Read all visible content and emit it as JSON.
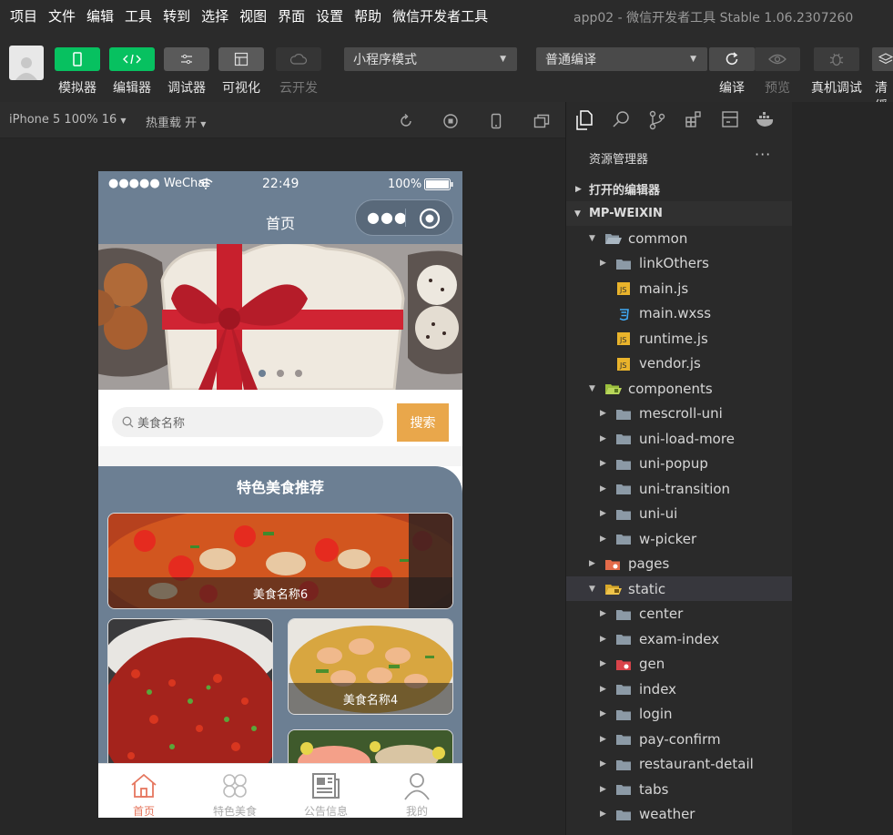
{
  "menu": [
    "项目",
    "文件",
    "编辑",
    "工具",
    "转到",
    "选择",
    "视图",
    "界面",
    "设置",
    "帮助",
    "微信开发者工具"
  ],
  "window_title": "app02 - 微信开发者工具 Stable 1.06.2307260",
  "toolbar": {
    "simulator": "模拟器",
    "editor": "编辑器",
    "debugger": "调试器",
    "visual": "可视化",
    "cloud": "云开发",
    "mode": "小程序模式",
    "compile": "普通编译",
    "compile_btn": "编译",
    "preview": "预览",
    "real_debug": "真机调试",
    "clear": "清缓"
  },
  "colors": {
    "green": "#07c160",
    "accent_nav": "#6c7f93",
    "search_btn": "#e9a74b",
    "tab_active": "#e5765e"
  },
  "simbar": {
    "device": "iPhone 5 100% 16",
    "hot_reload": "热重载 开"
  },
  "phone": {
    "status": {
      "signal": "●●●●● WeChat",
      "time": "22:49",
      "battery": "100%"
    },
    "nav_title": "首页",
    "search_placeholder": "美食名称",
    "search_button": "搜索",
    "section_title": "特色美食推荐",
    "cards": [
      {
        "label": "美食名称6"
      },
      {
        "label": ""
      },
      {
        "label": "美食名称4"
      },
      {
        "label": ""
      }
    ],
    "tabs": [
      {
        "label": "首页",
        "icon": "home-icon"
      },
      {
        "label": "特色美食",
        "icon": "grid-icon"
      },
      {
        "label": "公告信息",
        "icon": "news-icon"
      },
      {
        "label": "我的",
        "icon": "user-icon"
      }
    ]
  },
  "explorer": {
    "title": "资源管理器",
    "more": "···",
    "open_editors": "打开的编辑器",
    "project": "MP-WEIXIN",
    "tree": [
      {
        "name": "common",
        "type": "folder-open"
      },
      {
        "name": "linkOthers",
        "type": "folder"
      },
      {
        "name": "main.js",
        "type": "js"
      },
      {
        "name": "main.wxss",
        "type": "css"
      },
      {
        "name": "runtime.js",
        "type": "js"
      },
      {
        "name": "vendor.js",
        "type": "js"
      },
      {
        "name": "components",
        "type": "folder-open-special"
      },
      {
        "name": "mescroll-uni",
        "type": "folder"
      },
      {
        "name": "uni-load-more",
        "type": "folder"
      },
      {
        "name": "uni-popup",
        "type": "folder"
      },
      {
        "name": "uni-transition",
        "type": "folder"
      },
      {
        "name": "uni-ui",
        "type": "folder"
      },
      {
        "name": "w-picker",
        "type": "folder"
      },
      {
        "name": "pages",
        "type": "folder-pages"
      },
      {
        "name": "static",
        "type": "folder-open-static"
      },
      {
        "name": "center",
        "type": "folder"
      },
      {
        "name": "exam-index",
        "type": "folder"
      },
      {
        "name": "gen",
        "type": "folder-gen"
      },
      {
        "name": "index",
        "type": "folder"
      },
      {
        "name": "login",
        "type": "folder"
      },
      {
        "name": "pay-confirm",
        "type": "folder"
      },
      {
        "name": "restaurant-detail",
        "type": "folder"
      },
      {
        "name": "tabs",
        "type": "folder"
      },
      {
        "name": "weather",
        "type": "folder"
      }
    ]
  }
}
